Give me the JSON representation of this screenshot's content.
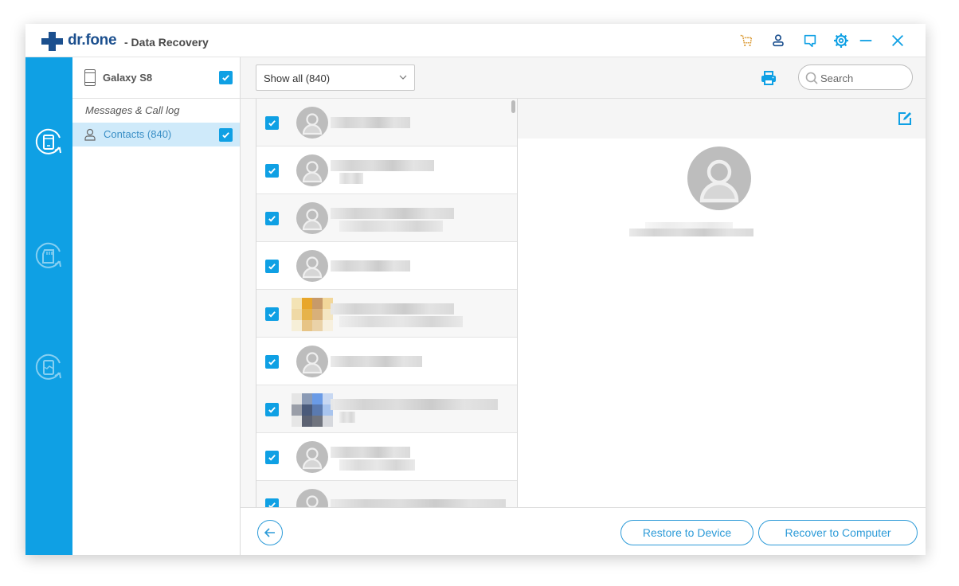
{
  "app": {
    "brand": "dr.fone",
    "title": "- Data Recovery",
    "colors": {
      "accent": "#0fa0e4",
      "brand": "#1b4f8e",
      "cart": "#d9962c",
      "selected_row": "#cfeafa"
    }
  },
  "titlebar": {
    "icons": [
      "cart-icon",
      "account-icon",
      "feedback-icon",
      "settings-icon",
      "minimize-icon",
      "close-icon"
    ]
  },
  "leftbar": {
    "items": [
      {
        "name": "recover-from-device",
        "icon": "phone-recover-icon",
        "active": true
      },
      {
        "name": "recover-from-sd-card",
        "icon": "sd-card-recover-icon",
        "active": false
      },
      {
        "name": "recover-from-broken-phone",
        "icon": "broken-phone-recover-icon",
        "active": false
      }
    ]
  },
  "device": {
    "name": "Galaxy S8",
    "checked": true,
    "category_label": "Messages & Call log",
    "categories": [
      {
        "label": "Contacts (840)",
        "checked": true,
        "selected": true
      }
    ]
  },
  "toolbar": {
    "filter_value": "Show all (840)",
    "search_placeholder": "Search"
  },
  "contacts": {
    "note": "Contact names are pixelated/redacted in the screenshot",
    "rows": [
      {
        "checked": true,
        "avatar": "default",
        "name": "[redacted]"
      },
      {
        "checked": true,
        "avatar": "default",
        "name": "[redacted]"
      },
      {
        "checked": true,
        "avatar": "default",
        "name": "[redacted]"
      },
      {
        "checked": true,
        "avatar": "default",
        "name": "[redacted]"
      },
      {
        "checked": true,
        "avatar": "photo-orange",
        "name": "[redacted]"
      },
      {
        "checked": true,
        "avatar": "default",
        "name": "[redacted]"
      },
      {
        "checked": true,
        "avatar": "photo-blue",
        "name": "[redacted]"
      },
      {
        "checked": true,
        "avatar": "default",
        "name": "[redacted]"
      },
      {
        "checked": true,
        "avatar": "default",
        "name": "[redacted]"
      }
    ]
  },
  "detail": {
    "name": "[redacted]",
    "avatar": "default"
  },
  "footer": {
    "restore_label": "Restore to Device",
    "recover_label": "Recover to Computer"
  }
}
